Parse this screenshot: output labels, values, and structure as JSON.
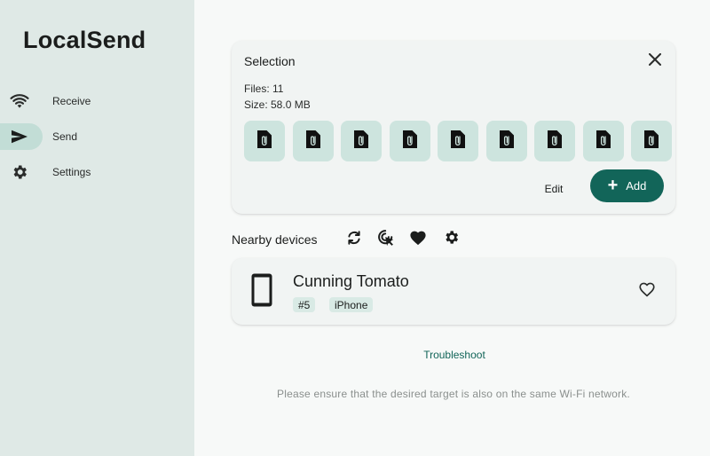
{
  "app": {
    "title": "LocalSend"
  },
  "sidebar": {
    "items": [
      {
        "label": "Receive",
        "icon": "wifi-icon",
        "active": false
      },
      {
        "label": "Send",
        "icon": "send-icon",
        "active": true
      },
      {
        "label": "Settings",
        "icon": "gear-icon",
        "active": false
      }
    ]
  },
  "selection": {
    "title": "Selection",
    "files": "Files: 11",
    "size": "Size: 58.0 MB",
    "file_icon": "attachment-file-icon",
    "edit_label": "Edit",
    "add_label": "Add",
    "close_icon": "close-icon"
  },
  "nearby": {
    "label": "Nearby devices",
    "tools": [
      "refresh-icon",
      "scan-target-icon",
      "favorites-heart-icon",
      "settings-gear-icon"
    ],
    "devices": [
      {
        "name": "Cunning Tomato",
        "badges": [
          "#5",
          "iPhone"
        ],
        "icon": "phone-icon"
      }
    ]
  },
  "troubleshoot_label": "Troubleshoot",
  "hint": "Please ensure that the desired target is also on the same Wi-Fi network.",
  "colors": {
    "accent": "#126559",
    "sidebar_bg": "#dfe9e6",
    "active_pill": "#c2ddd6",
    "file_tile": "#cde4de",
    "badge_bg": "#d9eae5"
  }
}
